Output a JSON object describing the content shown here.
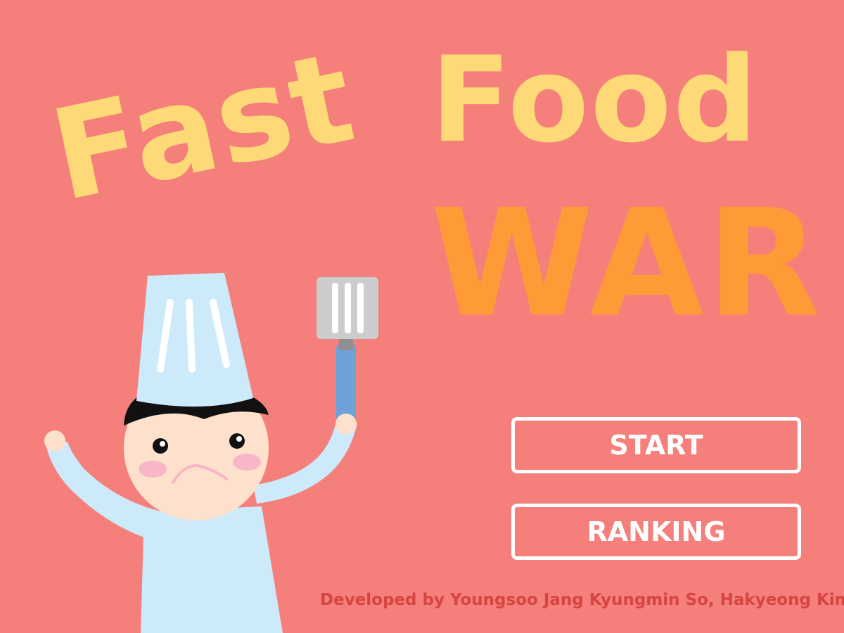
{
  "title": {
    "line1": "Fast",
    "line2": "Food",
    "line3": "WAR"
  },
  "menu": {
    "start_label": "START",
    "ranking_label": "RANKING"
  },
  "credits": "Developed by Youngsoo Jang Kyungmin So, Hakyeong Kim",
  "colors": {
    "background": "#f57f7a",
    "title_yellow": "#fed978",
    "title_orange": "#ff9b36",
    "button_border": "#ffffff",
    "credits_text": "#d6453f"
  },
  "icons": {
    "mascot": "chef-character",
    "utensil": "spatula-icon"
  }
}
